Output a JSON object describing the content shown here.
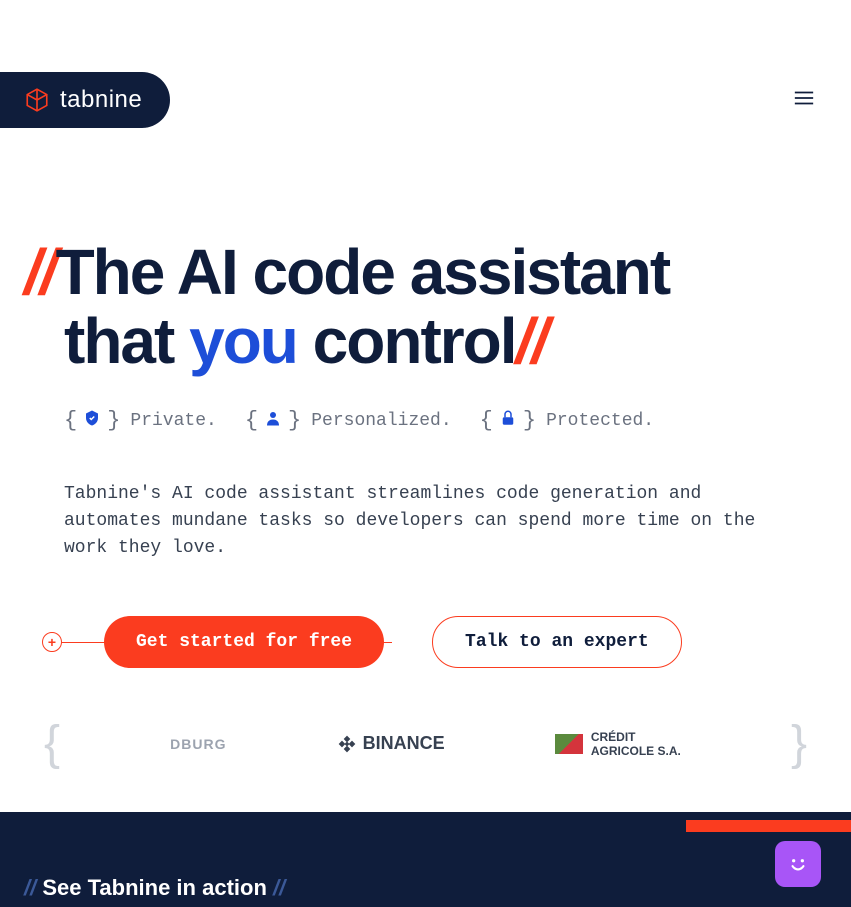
{
  "brand": {
    "name": "tabnine"
  },
  "hero": {
    "slash_open": "//",
    "title_line1": "The AI code assistant",
    "title_line2_prefix": "that ",
    "title_line2_highlight": "you",
    "title_line2_suffix": " control",
    "slash_close": "//"
  },
  "features": [
    {
      "label": "Private."
    },
    {
      "label": "Personalized."
    },
    {
      "label": "Protected."
    }
  ],
  "description": "Tabnine's AI code assistant streamlines code generation and automates mundane tasks so developers can spend more time on the work they love.",
  "cta": {
    "primary": "Get started for free",
    "secondary": "Talk to an expert"
  },
  "partners": {
    "partial": "DBURG",
    "binance": "BINANCE",
    "credit_line1": "CRÉDIT",
    "credit_line2": "AGRICOLE S.A."
  },
  "footer": {
    "slash_open": "//",
    "title": "See Tabnine in action",
    "slash_close": "//"
  }
}
